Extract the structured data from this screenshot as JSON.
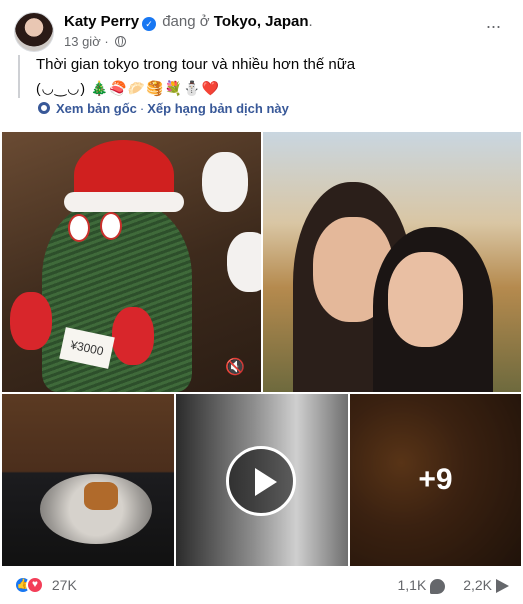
{
  "post": {
    "author": "Katy Perry",
    "location_prefix": "đang ở",
    "location": "Tokyo, Japan",
    "location_suffix": ".",
    "time": "13 giờ",
    "separator": "·",
    "more_label": "···",
    "text": "Thời gian tokyo trong tour và nhiều hơn thế nữa",
    "emoji_line": "(◡‿◡) 🎄🍣🥟🥞💐⛄❤️",
    "translation": {
      "see_original": "Xem bản gốc",
      "dot": "·",
      "rate": "Xếp hạng bản dịch này"
    }
  },
  "media": {
    "tag_text": "¥3000",
    "mute_label": "🔇",
    "more_photos": "+9"
  },
  "footer": {
    "reaction_count": "27K",
    "comments": "1,1K",
    "shares": "2,2K"
  },
  "colors": {
    "accent": "#1877f2",
    "love": "#f33e58",
    "secondary_text": "#65676b",
    "link": "#385898"
  }
}
